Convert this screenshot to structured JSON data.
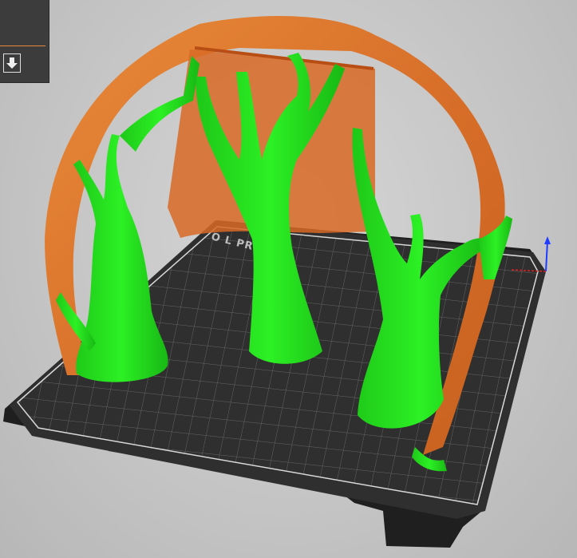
{
  "viewport": {
    "bed_label": "O L PRUSA",
    "colors": {
      "background": "#c9c9c9",
      "bed": "#2e2e2e",
      "grid": "#6e6e6e",
      "model": "#e07a30",
      "support": "#22e01a",
      "axis_z": "#1e3cff",
      "axis_x": "#e02020"
    }
  },
  "side_panel": {
    "divider_color": "#e58a3c",
    "export_icon": "download-arrow-icon"
  }
}
